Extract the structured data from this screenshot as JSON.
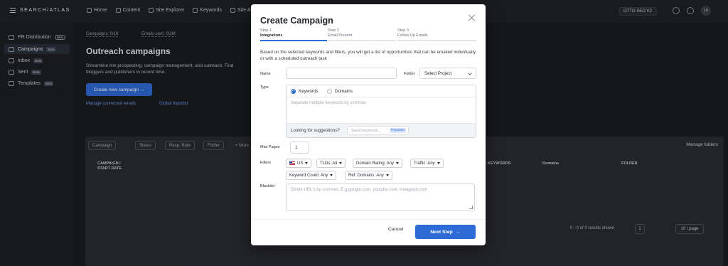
{
  "app": {
    "logo_text": "SEARCH/ATLAS",
    "nav": [
      "Home",
      "Content",
      "Site Explorer",
      "Keywords",
      "Site Audit"
    ],
    "otto_label": "OTTO SEO V2",
    "avatar_initials": "LA"
  },
  "sidebar": {
    "items": [
      {
        "label": "PR Distribution",
        "badge": "New"
      },
      {
        "label": "Campaigns",
        "badge": "Beta"
      },
      {
        "label": "Inbox",
        "badge": "Beta"
      },
      {
        "label": "Sent",
        "badge": "Beta"
      },
      {
        "label": "Templates",
        "badge": "Beta"
      }
    ]
  },
  "main": {
    "stats": [
      "Campaigns: 0/16",
      "Emails sent: 0/2M"
    ],
    "title": "Outreach campaigns",
    "description": "Streamline link prospecting, campaign management, and outreach. Find bloggers and publishers in record time.",
    "create_button": "Create new campaign",
    "links": [
      "Manage connected emails",
      "Global blacklist"
    ],
    "filters": [
      "Campaign",
      "Status",
      "Resp. Rate",
      "Folder",
      "+ More"
    ],
    "manage_folders": "Manage folders",
    "columns": [
      "CAMPAIGN /",
      "START DATE",
      "KEYWORDS",
      "Domains",
      "FOLDER"
    ],
    "pagination": {
      "summary": "0 - 0 of 0 results shown",
      "page": "1",
      "per_page": "10 / page"
    }
  },
  "modal": {
    "title": "Create Campaign",
    "steps": [
      {
        "num": "Step 1",
        "title": "Integrations"
      },
      {
        "num": "Step 2",
        "title": "Email Present"
      },
      {
        "num": "Step 3",
        "title": "Follow-Up Emails"
      }
    ],
    "intro": "Based on the selected keywords and filters, you will get a list of opportunities that can be emailed individually or with a scheduled outreach task",
    "labels": {
      "name": "Name",
      "folder": "Folder",
      "type": "Type",
      "max_pages": "Max Pages",
      "filters": "Filters",
      "blacklist": "Blacklist"
    },
    "name_value": "",
    "folder_placeholder": "Select Project",
    "type_options": [
      "Keywords",
      "Domains"
    ],
    "type_selected": "Keywords",
    "keywords_placeholder": "Separate multiple keywords by commas",
    "suggestions_label": "Looking for suggestions?",
    "seed_placeholder": "Seed keyword...",
    "populate_label": "Populate",
    "max_pages_value": "1",
    "filter_chips": [
      "US",
      "TLDs: All",
      "Domain Rating: Any",
      "Traffic: Any",
      "Keyword Count: Any",
      "Ref. Domains: Any"
    ],
    "blacklist_placeholder": "Divide URL's by commas. E.g google.com, youtube.com, instagram.com",
    "cancel_label": "Cancel",
    "next_label": "Next Step",
    "next_arrow": "→"
  },
  "colors": {
    "primary": "#2e6bd6",
    "background": "#1b1d22",
    "modal_bg": "#ffffff"
  }
}
